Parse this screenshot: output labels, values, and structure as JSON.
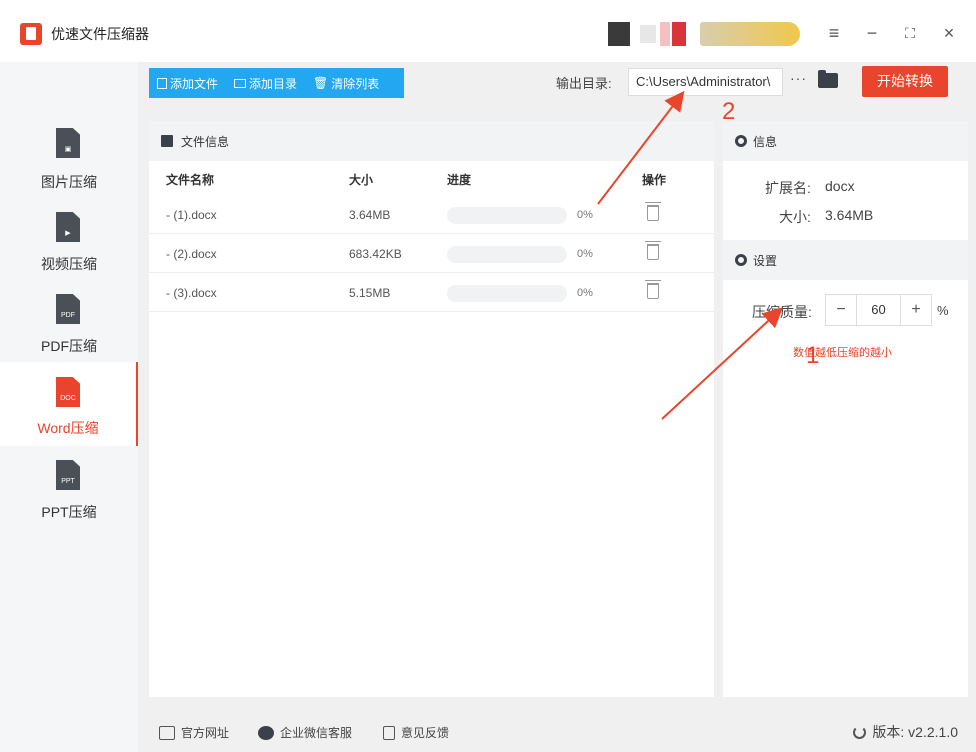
{
  "app": {
    "title": "优速文件压缩器"
  },
  "sidebar": {
    "items": [
      {
        "label": "图片压缩",
        "glyph": "▣"
      },
      {
        "label": "视频压缩",
        "glyph": "▶"
      },
      {
        "label": "PDF压缩",
        "glyph": "PDF"
      },
      {
        "label": "Word压缩",
        "glyph": "DOC"
      },
      {
        "label": "PPT压缩",
        "glyph": "PPT"
      }
    ]
  },
  "toolbar": {
    "add_file": "添加文件",
    "add_folder": "添加目录",
    "clear_list": "清除列表",
    "output_label": "输出目录:",
    "output_path": "C:\\Users\\Administrator\\",
    "more": "···",
    "start": "开始转换"
  },
  "file_panel": {
    "title": "文件信息",
    "columns": {
      "name": "文件名称",
      "size": "大小",
      "progress": "进度",
      "action": "操作"
    },
    "rows": [
      {
        "name": "- (1).docx",
        "size": "3.64MB",
        "pct": "0%"
      },
      {
        "name": "- (2).docx",
        "size": "683.42KB",
        "pct": "0%"
      },
      {
        "name": "- (3).docx",
        "size": "5.15MB",
        "pct": "0%"
      }
    ]
  },
  "info_panel": {
    "title": "信息",
    "ext_label": "扩展名:",
    "ext_value": "docx",
    "size_label": "大小:",
    "size_value": "3.64MB"
  },
  "settings_panel": {
    "title": "设置",
    "quality_label": "压缩质量:",
    "quality_value": "60",
    "minus": "−",
    "plus": "+",
    "percent": "%",
    "hint": "数值越低压缩的越小"
  },
  "annotations": {
    "one": "1",
    "two": "2"
  },
  "footer": {
    "website": "官方网址",
    "wechat": "企业微信客服",
    "feedback": "意见反馈",
    "version": "版本: v2.2.1.0"
  },
  "colors": {
    "accent": "#e8452c",
    "toolbar": "#22a7f0"
  }
}
